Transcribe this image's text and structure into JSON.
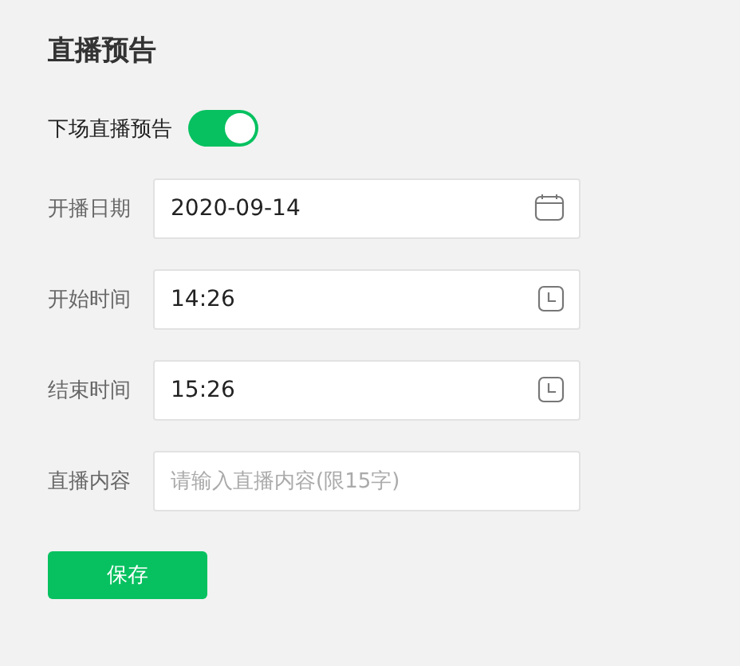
{
  "title": "直播预告",
  "toggle": {
    "label": "下场直播预告",
    "on": true
  },
  "fields": [
    {
      "label": "开播日期",
      "kind": "date",
      "value": "2020-09-14"
    },
    {
      "label": "开始时间",
      "kind": "time",
      "value": "14:26"
    },
    {
      "label": "结束时间",
      "kind": "time",
      "value": "15:26"
    },
    {
      "label": "直播内容",
      "kind": "text",
      "placeholder": "请输入直播内容(限15字)"
    }
  ],
  "buttons": [
    "保存"
  ]
}
